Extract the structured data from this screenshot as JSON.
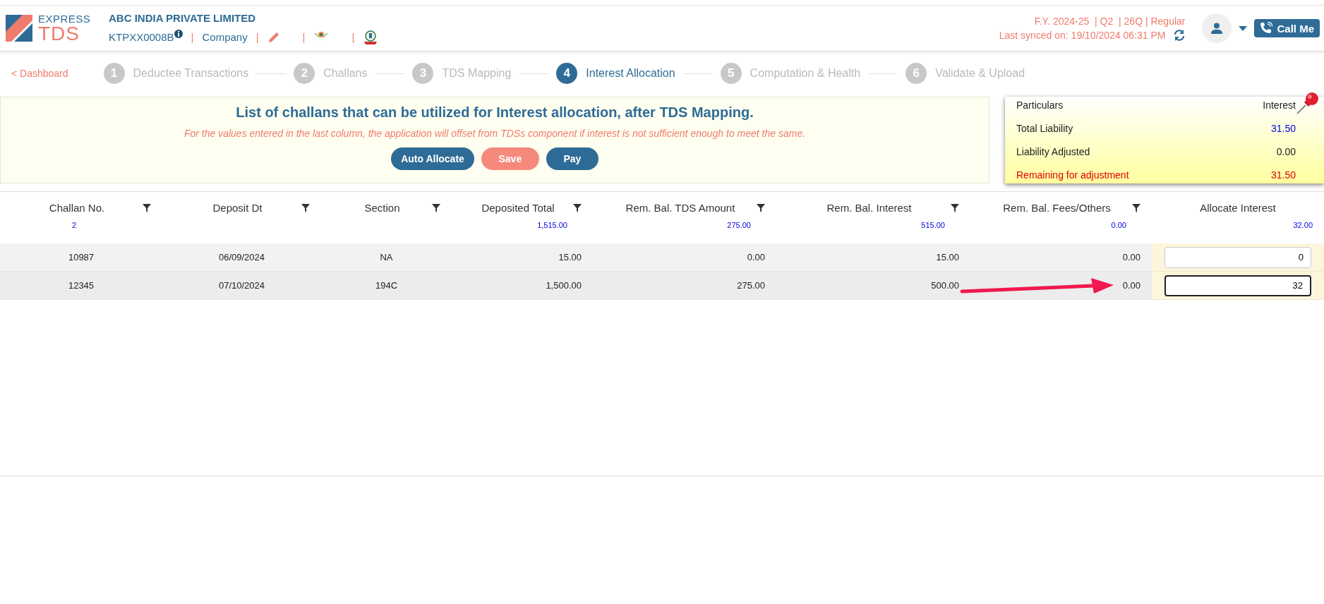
{
  "header": {
    "company": "ABC INDIA PRIVATE LIMITED",
    "tan": "KTPXX0008B",
    "entity": "Company",
    "separators": [
      "|",
      "|",
      "|",
      "|"
    ],
    "period": "F.Y. 2024-25  | Q2  | 26Q | Regular",
    "synced": "Last synced on: 19/10/2024 06:31 PM",
    "call_button": "Call Me",
    "logo": {
      "top": "EXPRESS",
      "bottom": "TDS"
    }
  },
  "nav": {
    "back": "< Dashboard",
    "steps": [
      {
        "number": "1",
        "label": "Deductee Transactions",
        "selected": false
      },
      {
        "number": "2",
        "label": "Challans",
        "selected": false
      },
      {
        "number": "3",
        "label": "TDS Mapping",
        "selected": false
      },
      {
        "number": "4",
        "label": "Interest Allocation",
        "selected": true
      },
      {
        "number": "5",
        "label": "Computation & Health",
        "selected": false
      },
      {
        "number": "6",
        "label": "Validate & Upload",
        "selected": false
      }
    ]
  },
  "banner": {
    "title": "List of challans that can be utilized for Interest allocation, after TDS Mapping.",
    "note": "For the values entered in the last column, the application will offset from TDSs component if interest is not sufficient enough to meet the same.",
    "buttons": [
      {
        "label": "Auto Allocate",
        "kind": "primary"
      },
      {
        "label": "Save",
        "kind": "warm"
      },
      {
        "label": "Pay",
        "kind": "primary"
      }
    ]
  },
  "summary": {
    "rows": [
      {
        "label": "Particulars",
        "value": "Interest",
        "kind": "head"
      },
      {
        "label": "Total Liability",
        "value": "31.50",
        "kind": "total"
      },
      {
        "label": "Liability Adjusted",
        "value": "0.00",
        "kind": "plain"
      },
      {
        "label": "Remaining for adjustment",
        "value": "31.50",
        "kind": "alert"
      }
    ]
  },
  "table": {
    "columns": [
      {
        "label": "Challan No.",
        "total": "2",
        "filter": true,
        "kind": "text"
      },
      {
        "label": "Deposit Dt",
        "filter": true,
        "kind": "text"
      },
      {
        "label": "Section",
        "filter": true,
        "kind": "text"
      },
      {
        "label": "Deposited Total",
        "total": "1,515.00",
        "filter": true,
        "kind": "amount"
      },
      {
        "label": "Rem. Bal. TDS Amount",
        "total": "275.00",
        "filter": true,
        "kind": "amount"
      },
      {
        "label": "Rem. Bal. Interest",
        "total": "515.00",
        "filter": true,
        "kind": "amount"
      },
      {
        "label": "Rem. Bal. Fees/Others",
        "total": "0.00",
        "filter": true,
        "kind": "amount"
      },
      {
        "label": "Allocate Interest",
        "total": "32.00",
        "filter": false,
        "kind": "input"
      }
    ],
    "rows": [
      {
        "cells": [
          "10987",
          "06/09/2024",
          "NA",
          "15.00",
          "0.00",
          "15.00",
          "0.00"
        ],
        "allocate": "0",
        "focused": false
      },
      {
        "cells": [
          "12345",
          "07/10/2024",
          "194C",
          "1,500.00",
          "275.00",
          "500.00",
          "0.00"
        ],
        "allocate": "32",
        "focused": true
      }
    ]
  }
}
